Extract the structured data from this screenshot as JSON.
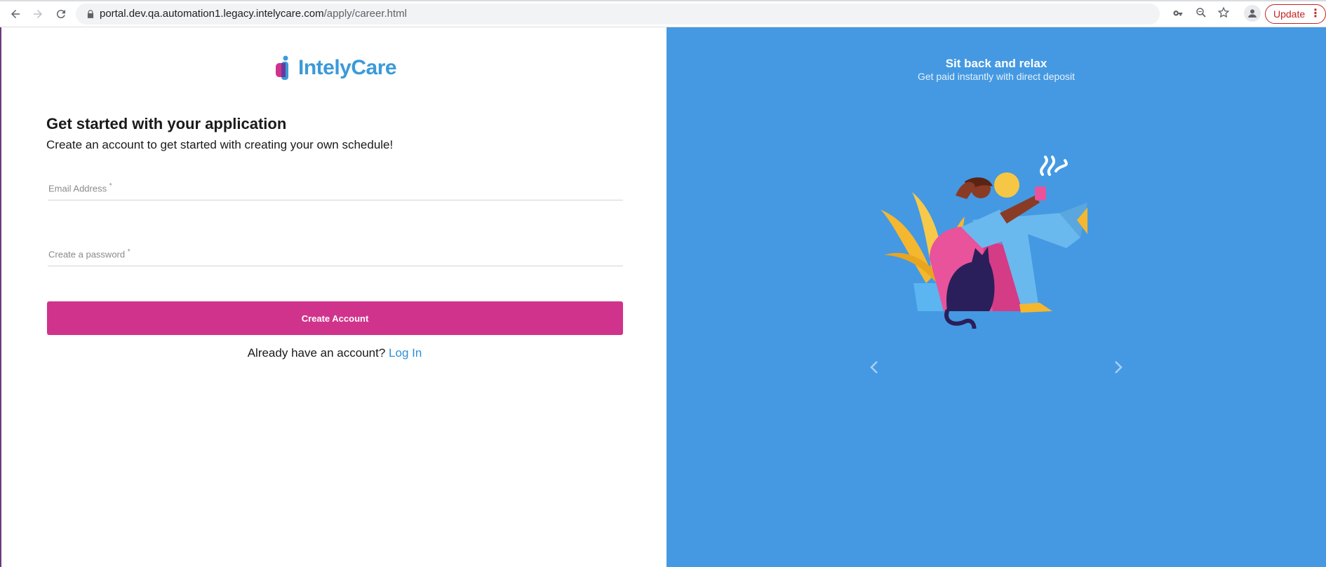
{
  "browser": {
    "url_host": "portal.dev.qa.automation1.legacy.intelycare.com",
    "url_path": "/apply/career.html",
    "update_label": "Update",
    "icons": [
      "back-icon",
      "forward-icon",
      "reload-icon",
      "lock-icon",
      "key-icon",
      "zoom-icon",
      "star-icon",
      "profile-icon",
      "menu-dots-icon"
    ]
  },
  "brand": {
    "name": "IntelyCare",
    "color": "#3a9ad9",
    "accent": "#d0338b"
  },
  "form": {
    "heading": "Get started with your application",
    "subheading": "Create an account to get started with creating your own schedule!",
    "email_label": "Email Address",
    "password_label": "Create a password",
    "required_mark": "*",
    "submit_label": "Create Account",
    "login_prompt": "Already have an account?",
    "login_link": "Log In"
  },
  "carousel": {
    "title": "Sit back and relax",
    "subtitle": "Get paid instantly with direct deposit",
    "background": "#4499e2",
    "icons": [
      "chevron-left-icon",
      "chevron-right-icon"
    ]
  }
}
